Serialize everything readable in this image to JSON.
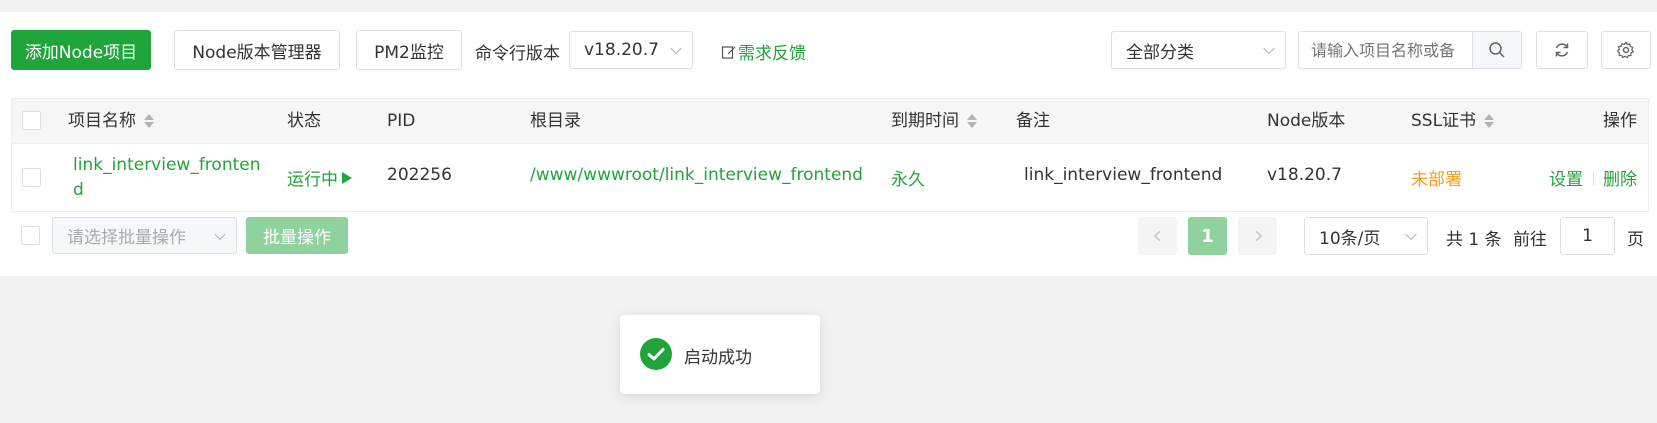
{
  "toolbar": {
    "add_node_label": "添加Node项目",
    "version_manager_label": "Node版本管理器",
    "pm2_label": "PM2监控",
    "cmd_version_label": "命令行版本",
    "cmd_version_value": "v18.20.7",
    "feedback_label": "需求反馈",
    "category_value": "全部分类",
    "search_placeholder": "请输入项目名称或备"
  },
  "table": {
    "columns": [
      "项目名称",
      "状态",
      "PID",
      "根目录",
      "到期时间",
      "备注",
      "Node版本",
      "SSL证书",
      "操作"
    ],
    "rows": [
      {
        "name_line1": "link_interview_fronten",
        "name_line2": "d",
        "status": "运行中",
        "pid": "202256",
        "root": "/www/wwwroot/link_interview_frontend",
        "expire": "永久",
        "remark": "link_interview_frontend",
        "node_version": "v18.20.7",
        "ssl": "未部署",
        "action_settings": "设置",
        "action_delete": "删除"
      }
    ]
  },
  "footer": {
    "batch_placeholder": "请选择批量操作",
    "batch_button": "批量操作",
    "current_page": "1",
    "page_size": "10条/页",
    "total_text": "共 1 条",
    "goto_label": "前往",
    "goto_value": "1",
    "page_suffix": "页"
  },
  "toast": {
    "message": "启动成功"
  },
  "colors": {
    "accent": "#20a53a",
    "warning": "#f0a020"
  }
}
